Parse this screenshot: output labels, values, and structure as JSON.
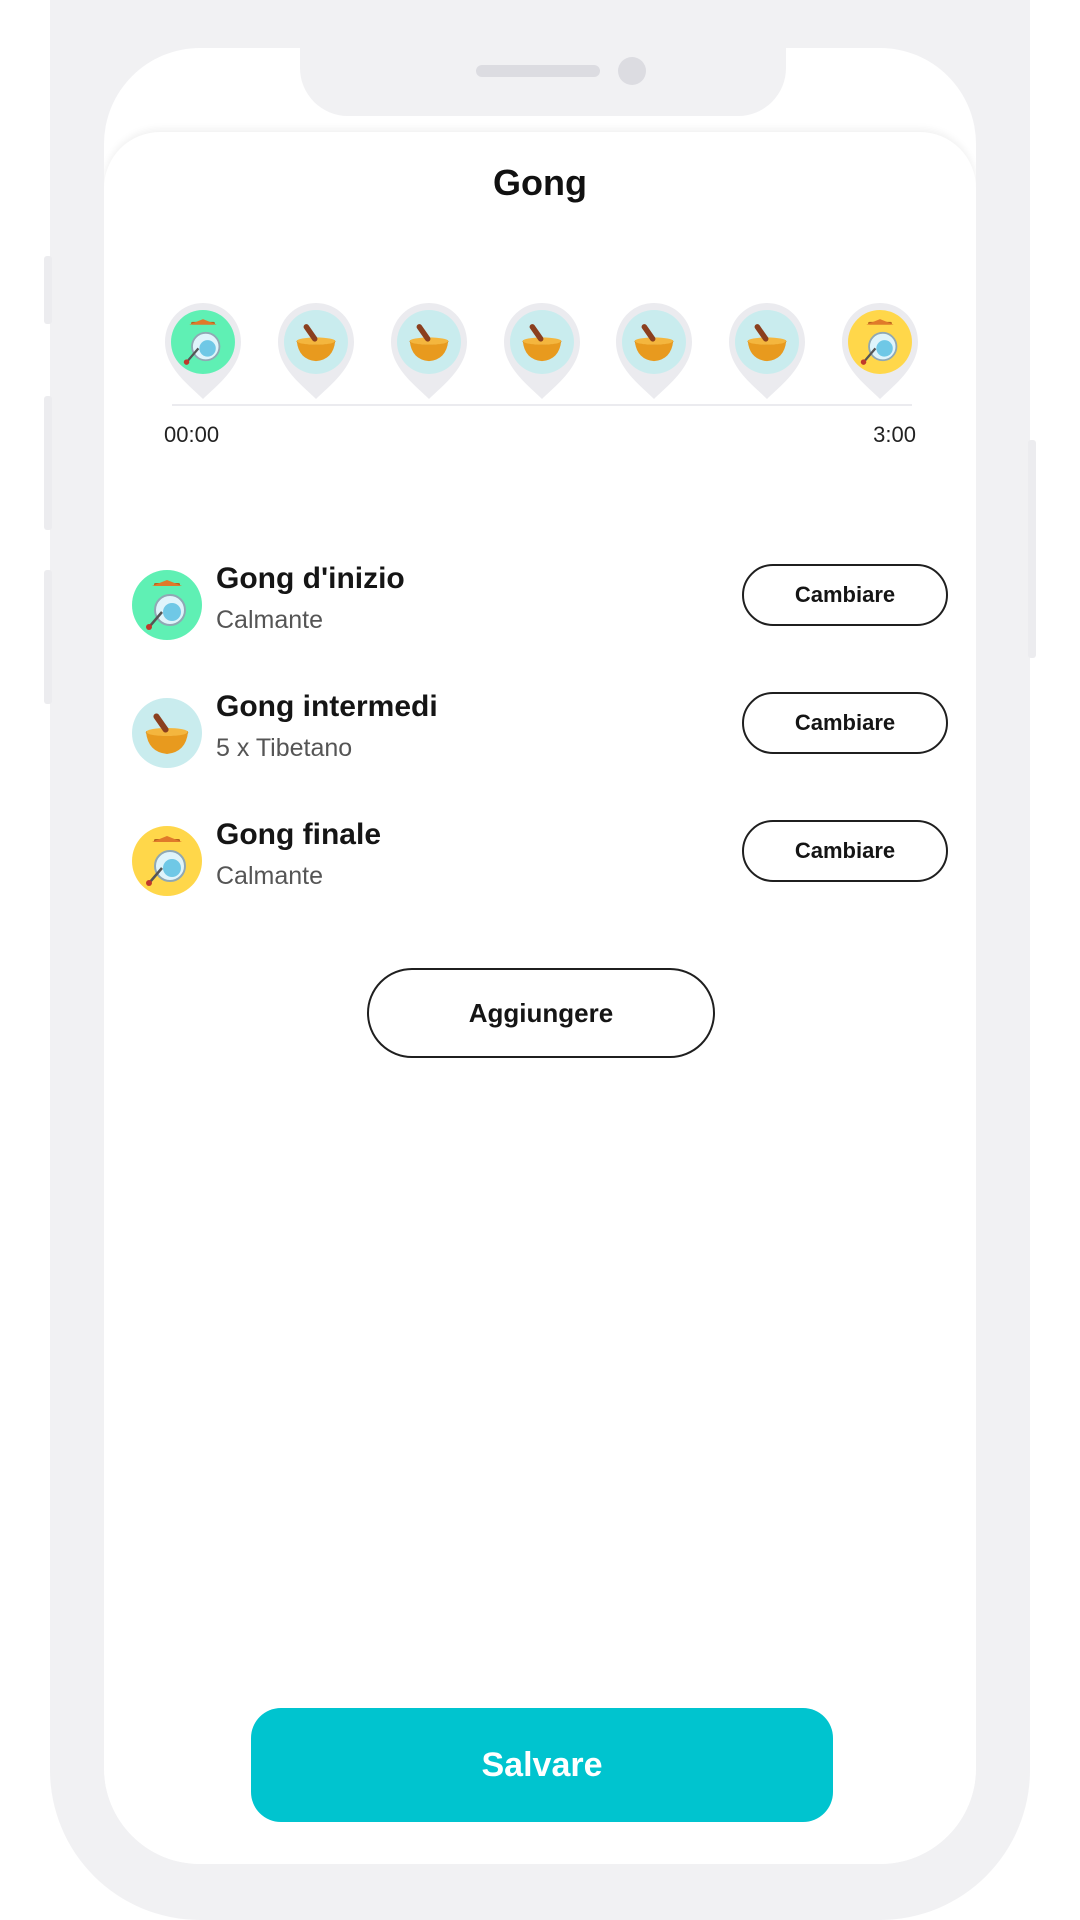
{
  "header": {
    "title": "Gong"
  },
  "timeline": {
    "start_label": "00:00",
    "end_label": "3:00",
    "markers": [
      {
        "kind": "gong",
        "color": "#5ff0b4"
      },
      {
        "kind": "bowl",
        "color": "#c9ecee"
      },
      {
        "kind": "bowl",
        "color": "#c9ecee"
      },
      {
        "kind": "bowl",
        "color": "#c9ecee"
      },
      {
        "kind": "bowl",
        "color": "#c9ecee"
      },
      {
        "kind": "bowl",
        "color": "#c9ecee"
      },
      {
        "kind": "gong",
        "color": "#ffd74a"
      }
    ]
  },
  "gongs": [
    {
      "name": "Gong d'inizio",
      "sound": "Calmante",
      "button": "Cambiare",
      "icon": "gong-icon",
      "color": "#5ff0b4"
    },
    {
      "name": "Gong intermedi",
      "sound": "5 x Tibetano",
      "button": "Cambiare",
      "icon": "singing-bowl-icon",
      "color": "#c9ecee"
    },
    {
      "name": "Gong finale",
      "sound": "Calmante",
      "button": "Cambiare",
      "icon": "gong-icon",
      "color": "#ffd74a"
    }
  ],
  "add_label": "Aggiungere",
  "save_label": "Salvare",
  "colors": {
    "accent": "#00c4cf",
    "frame": "#f1f1f3"
  }
}
